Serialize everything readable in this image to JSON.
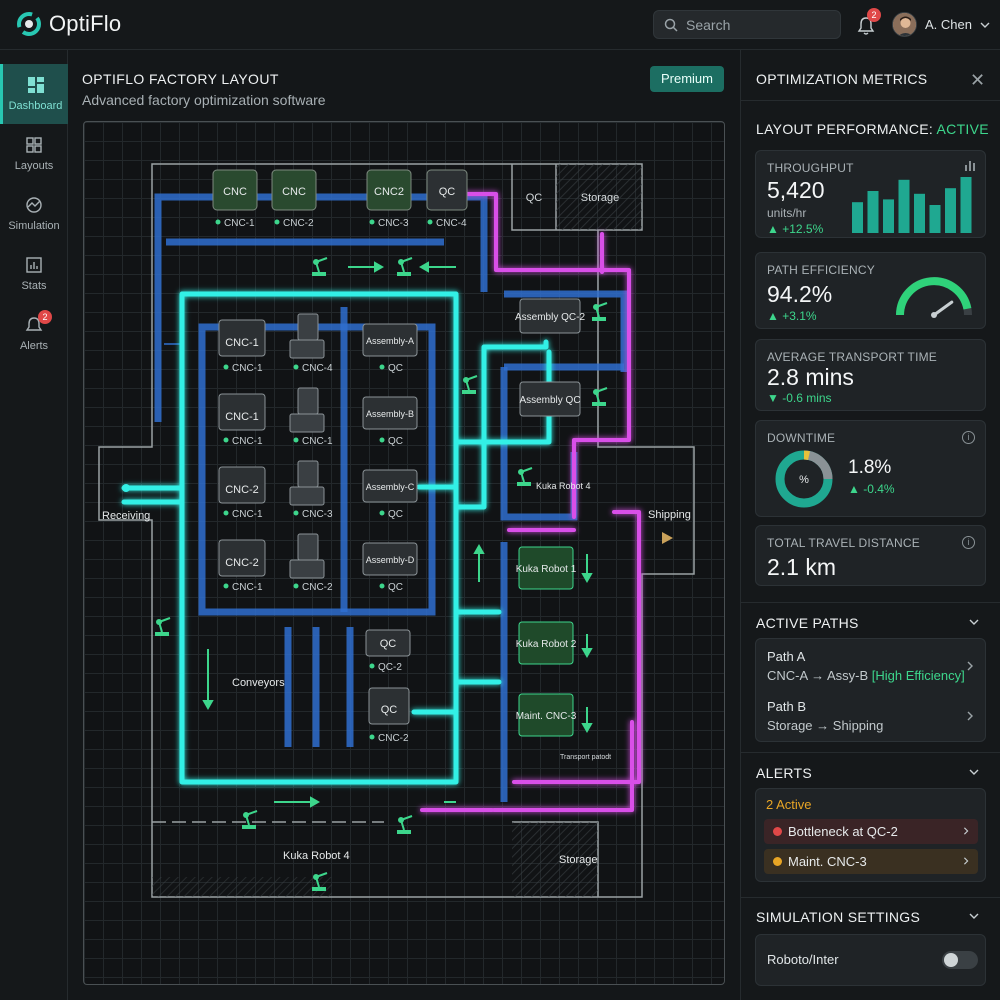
{
  "app": {
    "name": "OptiFlo",
    "search_placeholder": "Search",
    "notification_count": "2",
    "user_name": "A. Chen"
  },
  "sidebar": {
    "items": [
      {
        "label": "Dashboard",
        "icon": "dashboard-icon",
        "active": true
      },
      {
        "label": "Layouts",
        "icon": "layouts-icon"
      },
      {
        "label": "Simulation",
        "icon": "simulation-icon"
      },
      {
        "label": "Stats",
        "icon": "stats-icon"
      },
      {
        "label": "Alerts",
        "icon": "bell-icon",
        "badge": "2"
      }
    ]
  },
  "main": {
    "title": "OPTIFLO FACTORY LAYOUT",
    "subtitle": "Advanced factory optimization software",
    "premium_label": "Premium"
  },
  "layout": {
    "top_machines": [
      {
        "box": "CNC",
        "tag": "CNC-1"
      },
      {
        "box": "CNC",
        "tag": "CNC-2"
      },
      {
        "box": "CNC2",
        "tag": "CNC-3"
      },
      {
        "box": "QC",
        "tag": "CNC-4"
      }
    ],
    "top_rooms": [
      "QC",
      "Storage"
    ],
    "col1": [
      {
        "box": "CNC-1",
        "tag": "CNC-1"
      },
      {
        "box": "CNC-1",
        "tag": "CNC-1"
      },
      {
        "box": "CNC-2",
        "tag": "CNC-1"
      },
      {
        "box": "CNC-2",
        "tag": "CNC-1"
      }
    ],
    "col2_tags": [
      "CNC-4",
      "CNC-1",
      "CNC-3",
      "CNC-2"
    ],
    "col3": [
      {
        "box": "Assembly-A",
        "tag": "QC"
      },
      {
        "box": "Assembly-B",
        "tag": "QC"
      },
      {
        "box": "Assembly-C",
        "tag": "QC"
      },
      {
        "box": "Assembly-D",
        "tag": "QC"
      }
    ],
    "qc_boxes": [
      {
        "box": "QC",
        "tag": "QC-2"
      },
      {
        "box": "QC",
        "tag": "CNC-2"
      }
    ],
    "assembly_qc2": "Assembly QC-2",
    "assembly_qc": "Assembly QC",
    "kuka_robot4_right": "Kuka Robot 4",
    "green_stations": [
      "Kuka Robot 1",
      "Kuka Robot 2",
      "Maint. CNC-3"
    ],
    "transport_label": "Transport patodt",
    "receiving_label": "Receiving",
    "shipping_label": "Shipping",
    "conveyors_label": "Conveyors",
    "storage_bottom": "Storage",
    "kuka_robot4_bottom": "Kuka Robot 4"
  },
  "metrics": {
    "panel_title": "OPTIMIZATION METRICS",
    "performance_label": "LAYOUT PERFORMANCE: ",
    "performance_status": "ACTIVE",
    "throughput": {
      "label": "THROUGHPUT",
      "value": "5,420",
      "unit": "units/hr",
      "delta": "▲ +12.5%",
      "bars": [
        0.55,
        0.75,
        0.6,
        0.95,
        0.7,
        0.5,
        0.8,
        1.0
      ]
    },
    "path_efficiency": {
      "label": "PATH EFFICIENCY",
      "value": "94.2%",
      "delta": "▲ +3.1%",
      "gauge": 0.942
    },
    "transport_time": {
      "label": "AVERAGE TRANSPORT TIME",
      "value": "2.8 mins",
      "delta": "▼ -0.6 mins"
    },
    "downtime": {
      "label": "DOWNTIME",
      "value": "1.8%",
      "delta": "▲ -0.4%",
      "center": "%"
    },
    "travel": {
      "label": "TOTAL TRAVEL DISTANCE",
      "value": "2.1 km"
    }
  },
  "active_paths": {
    "title": "ACTIVE PATHS",
    "items": [
      {
        "name": "Path A",
        "from": "CNC-A",
        "to": "Assy-B",
        "tag": "[High Efficiency]"
      },
      {
        "name": "Path B",
        "from": "Storage",
        "to": "Shipping",
        "tag": ""
      }
    ]
  },
  "alerts": {
    "title": "ALERTS",
    "count_label": "2 Active",
    "items": [
      {
        "text": "Bottleneck at QC-2",
        "color": "#e04848"
      },
      {
        "text": "Maint. CNC-3",
        "color": "#e8a525"
      }
    ]
  },
  "simulation": {
    "title": "SIMULATION SETTINGS",
    "toggle_label": "Roboto/Inter",
    "toggle_on": false
  },
  "colors": {
    "accent": "#28c7b2",
    "path_cyan": "#33f0e6",
    "path_magenta": "#d94fe8",
    "conveyor_blue": "#2f6fcf",
    "ok_green": "#3dd68c"
  }
}
